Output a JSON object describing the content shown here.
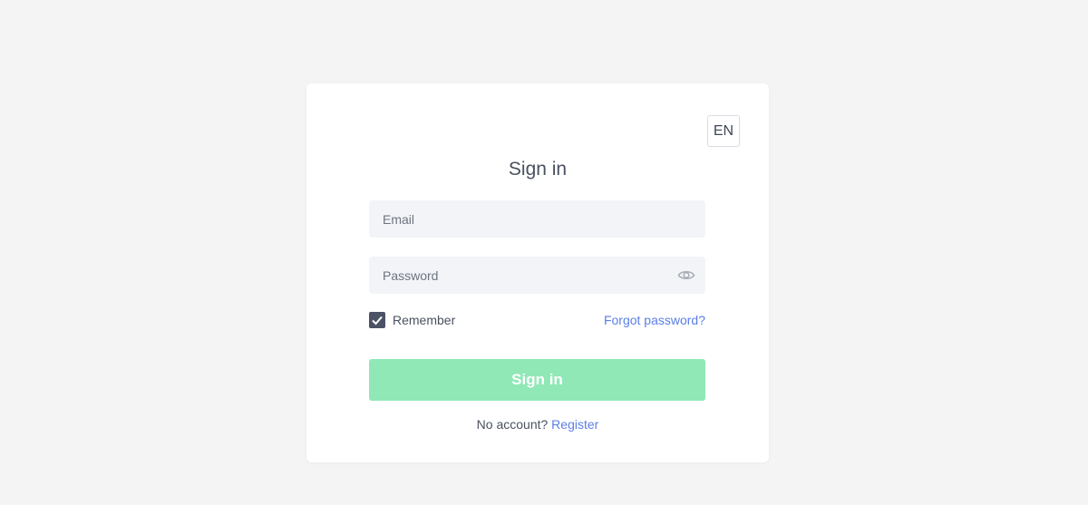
{
  "language": "EN",
  "title": "Sign in",
  "form": {
    "email_placeholder": "Email",
    "password_placeholder": "Password",
    "remember_label": "Remember",
    "remember_checked": true,
    "forgot_label": "Forgot password?",
    "submit_label": "Sign in"
  },
  "footer": {
    "prompt": "No account?",
    "register_label": "Register"
  },
  "colors": {
    "background": "#f4f4f4",
    "card": "#ffffff",
    "input_bg": "#f3f4f7",
    "link": "#5b7fe6",
    "submit_button": "#8fe8b6",
    "checkbox": "#4c5266",
    "text": "#4a5160"
  },
  "icons": {
    "password_toggle": "eye-icon",
    "checkbox_mark": "checkmark-icon"
  }
}
